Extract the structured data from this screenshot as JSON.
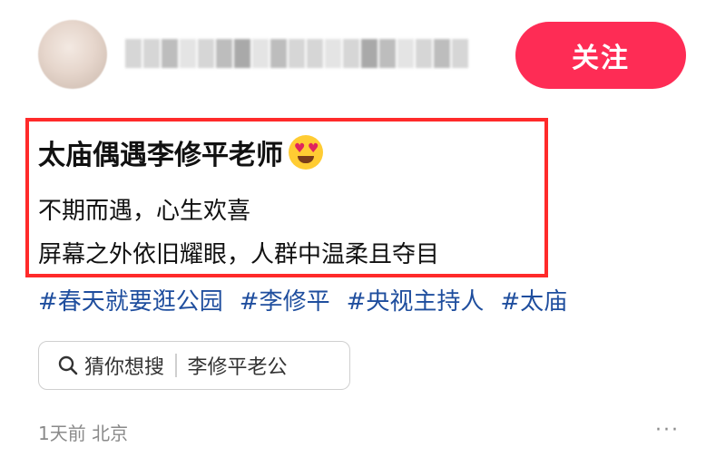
{
  "header": {
    "follow_label": "关注"
  },
  "post": {
    "title": "太庙偶遇李修平老师",
    "title_emoji": "heart-eyes-emoji",
    "lines": [
      "不期而遇，心生欢喜",
      "屏幕之外依旧耀眼，人群中温柔且夺目"
    ],
    "hashtags": [
      "#春天就要逛公园",
      "#李修平",
      "#央视主持人",
      "#太庙"
    ]
  },
  "search_suggestion": {
    "prefix": "猜你想搜",
    "query": "李修平老公"
  },
  "meta": {
    "time": "1天前",
    "location": "北京"
  },
  "colors": {
    "follow_button": "#fe2c55",
    "highlight_border": "#ff2a2a",
    "hashtag": "#1f4e9e",
    "meta_text": "#8a8a8a"
  }
}
